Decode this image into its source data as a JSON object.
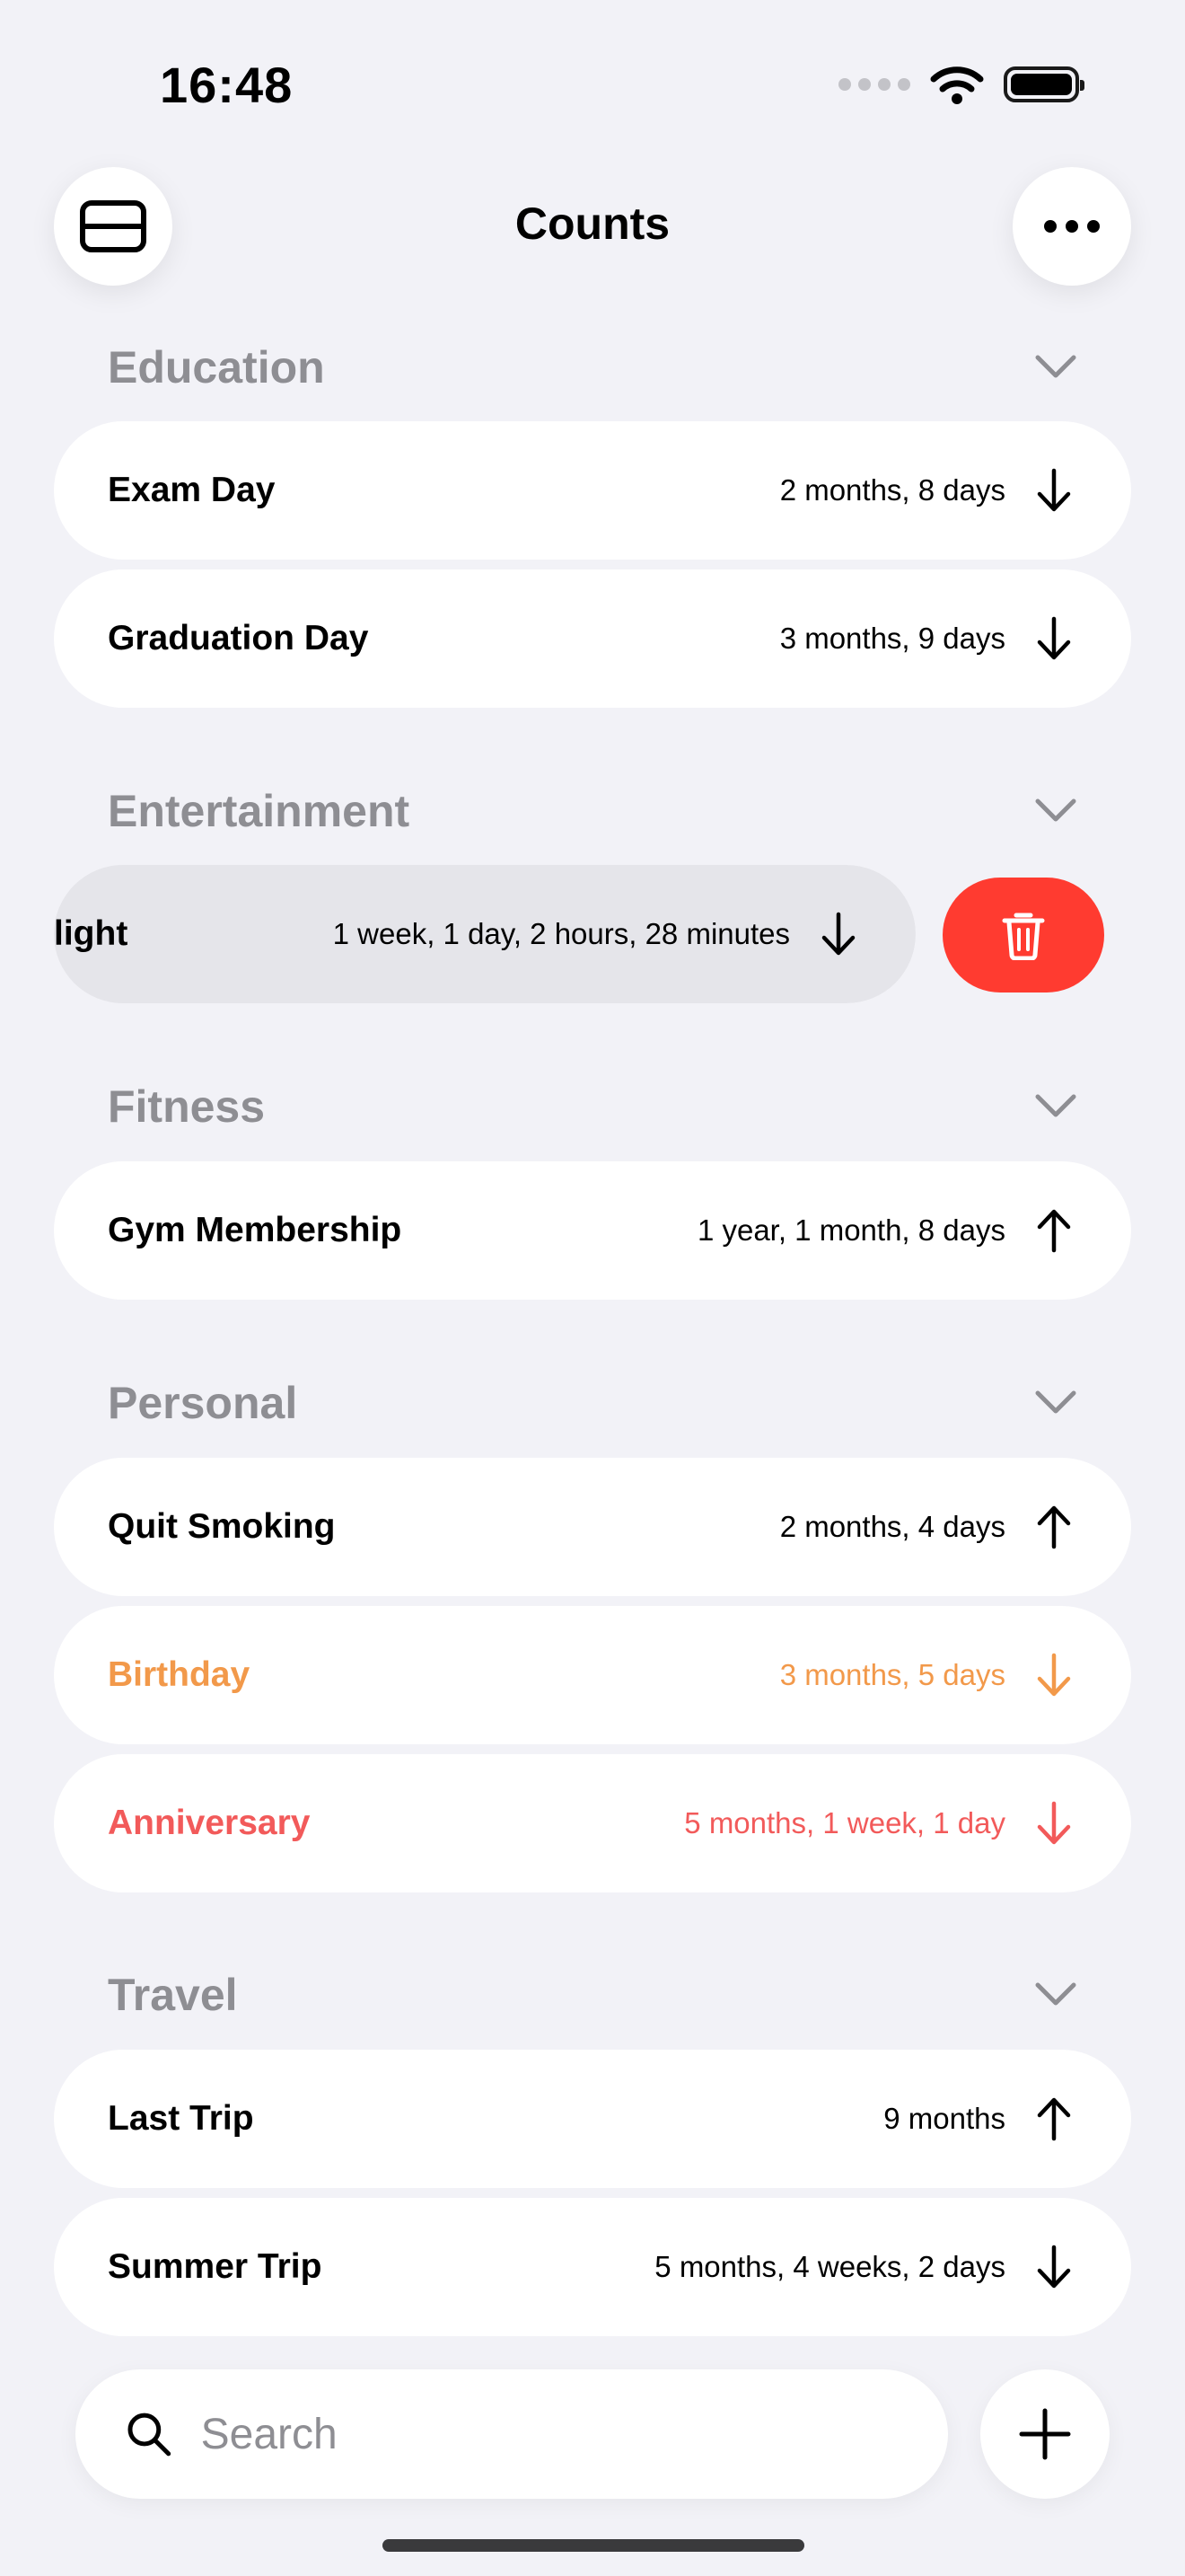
{
  "status_bar": {
    "time": "16:48"
  },
  "nav": {
    "title": "Counts"
  },
  "sections": {
    "education": {
      "title": "Education",
      "items": [
        {
          "title": "Exam Day",
          "value": "2 months, 8 days",
          "direction": "down"
        },
        {
          "title": "Graduation Day",
          "value": "3 months, 9 days",
          "direction": "down"
        }
      ]
    },
    "entertainment": {
      "title": "Entertainment",
      "items": [
        {
          "title": "light",
          "value": "1 week, 1 day, 2 hours, 28 minutes",
          "direction": "down"
        }
      ]
    },
    "fitness": {
      "title": "Fitness",
      "items": [
        {
          "title": "Gym Membership",
          "value": "1 year, 1 month, 8 days",
          "direction": "up"
        }
      ]
    },
    "personal": {
      "title": "Personal",
      "items": [
        {
          "title": "Quit Smoking",
          "value": "2 months, 4 days",
          "direction": "up"
        },
        {
          "title": "Birthday",
          "value": "3 months, 5 days",
          "direction": "down",
          "color": "#f2994a"
        },
        {
          "title": "Anniversary",
          "value": "5 months, 1 week, 1 day",
          "direction": "down",
          "color": "#f25a5a"
        }
      ]
    },
    "travel": {
      "title": "Travel",
      "items": [
        {
          "title": "Last Trip",
          "value": "9 months",
          "direction": "up"
        },
        {
          "title": "Summer Trip",
          "value": "5 months, 4 weeks, 2 days",
          "direction": "down"
        }
      ]
    }
  },
  "search": {
    "placeholder": "Search"
  },
  "colors": {
    "delete": "#ff3b30",
    "background": "#f2f2f7"
  }
}
